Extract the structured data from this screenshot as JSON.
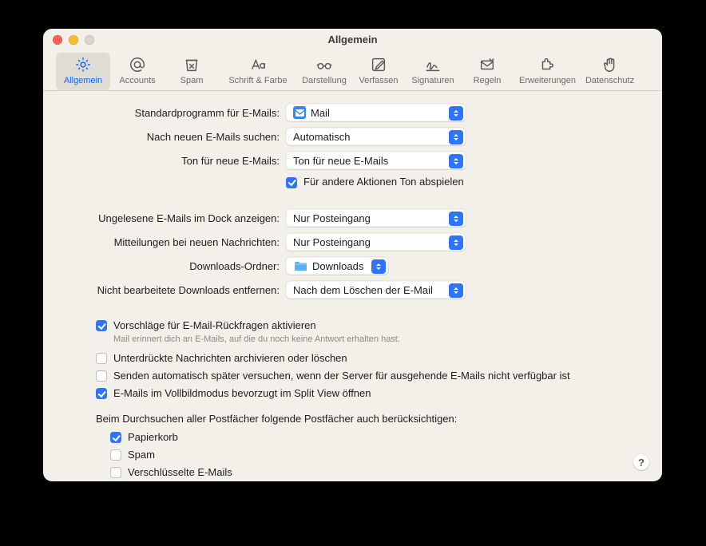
{
  "window": {
    "title": "Allgemein"
  },
  "toolbar": [
    {
      "name": "Allgemein",
      "active": true
    },
    {
      "name": "Accounts"
    },
    {
      "name": "Spam"
    },
    {
      "name": "Schrift & Farbe"
    },
    {
      "name": "Darstellung"
    },
    {
      "name": "Verfassen"
    },
    {
      "name": "Signaturen"
    },
    {
      "name": "Regeln"
    },
    {
      "name": "Erweiterungen"
    },
    {
      "name": "Datenschutz"
    }
  ],
  "rows": {
    "default_app": {
      "label": "Standardprogramm für E-Mails:",
      "value": "Mail"
    },
    "check_mail": {
      "label": "Nach neuen E-Mails suchen:",
      "value": "Automatisch"
    },
    "new_sound": {
      "label": "Ton für neue E-Mails:",
      "value": "Ton für neue E-Mails"
    },
    "play_other": {
      "label": "Für andere Aktionen Ton abspielen"
    },
    "dock_unread": {
      "label": "Ungelesene E-Mails im Dock anzeigen:",
      "value": "Nur Posteingang"
    },
    "notifications": {
      "label": "Mitteilungen bei neuen Nachrichten:",
      "value": "Nur Posteingang"
    },
    "downloads": {
      "label": "Downloads-Ordner:",
      "value": "Downloads"
    },
    "remove_dl": {
      "label": "Nicht bearbeitete Downloads entfernen:",
      "value": "Nach dem Löschen der E-Mail"
    }
  },
  "checks": {
    "followup": {
      "label": "Vorschläge für E-Mail-Rückfragen aktivieren",
      "checked": true,
      "hint": "Mail erinnert dich an E-Mails, auf die du noch keine Antwort erhalten hast."
    },
    "archive": {
      "label": "Unterdrückte Nachrichten archivieren oder löschen",
      "checked": false
    },
    "retry_send": {
      "label": "Senden automatisch später versuchen, wenn der Server für ausgehende E-Mails nicht verfügbar ist",
      "checked": false
    },
    "splitview": {
      "label": "E-Mails im Vollbildmodus bevorzugt im Split View öffnen",
      "checked": true
    }
  },
  "search_section": {
    "label": "Beim Durchsuchen aller Postfächer folgende Postfächer auch berücksichtigen:",
    "items": [
      {
        "label": "Papierkorb",
        "checked": true
      },
      {
        "label": "Spam",
        "checked": false
      },
      {
        "label": "Verschlüsselte E-Mails",
        "checked": false
      }
    ]
  },
  "help": "?"
}
